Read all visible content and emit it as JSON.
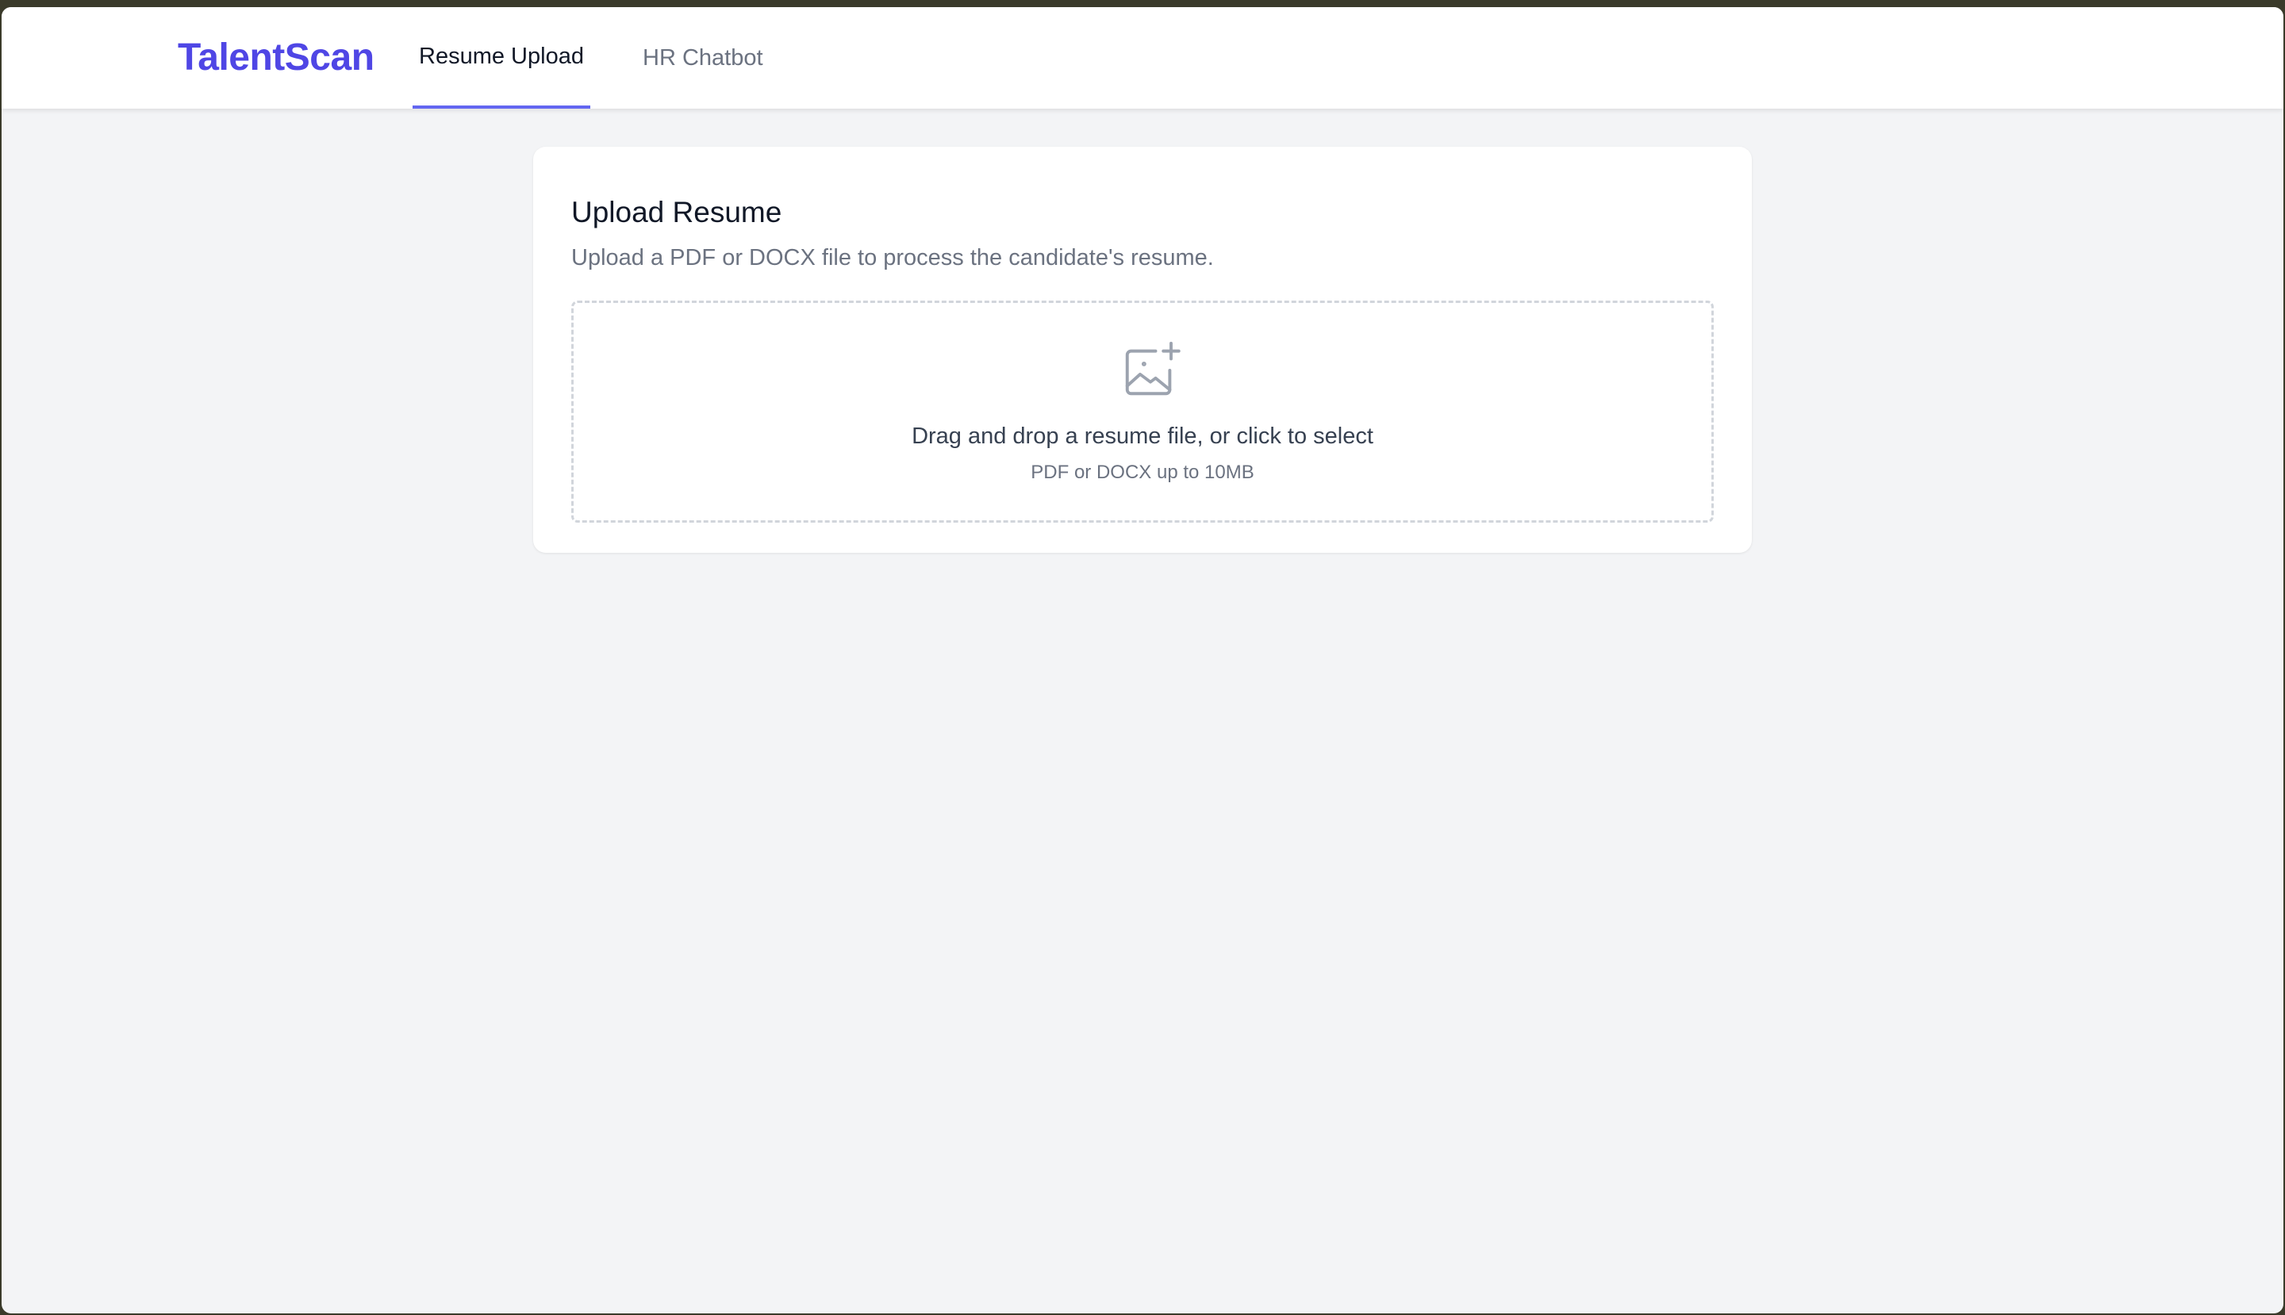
{
  "app": {
    "brand": "TalentScan"
  },
  "nav": {
    "tabs": [
      {
        "label": "Resume Upload",
        "active": true
      },
      {
        "label": "HR Chatbot",
        "active": false
      }
    ]
  },
  "upload_card": {
    "title": "Upload Resume",
    "description": "Upload a PDF or DOCX file to process the candidate's resume.",
    "dropzone": {
      "icon": "image-add-icon",
      "primary_text": "Drag and drop a resume file, or click to select",
      "secondary_text": "PDF or DOCX up to 10MB"
    }
  },
  "colors": {
    "brand": "#4f46e5",
    "active_tab_indicator": "#6366f1",
    "page_background": "#f3f4f6",
    "dropzone_border": "#d1d5db"
  }
}
